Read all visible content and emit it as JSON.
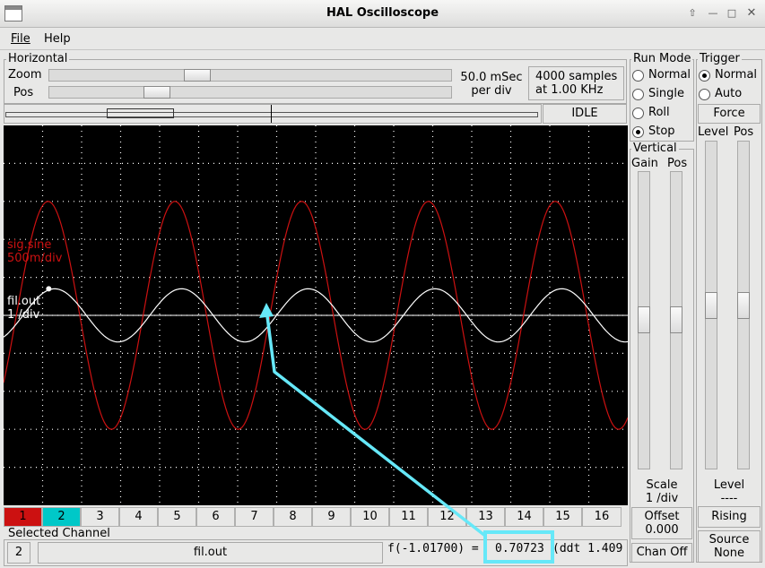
{
  "window": {
    "title": "HAL Oscilloscope"
  },
  "menu": {
    "file": "File",
    "help": "Help"
  },
  "horizontal": {
    "legend": "Horizontal",
    "zoom_label": "Zoom",
    "pos_label": "Pos",
    "timebase": "50.0 mSec",
    "timebase_sub": "per div",
    "samples": "4000 samples",
    "samples_rate": "at 1.00 KHz",
    "zoom_level": 0.36,
    "pos_level": 0.25
  },
  "status": "IDLE",
  "run_mode": {
    "legend": "Run Mode",
    "options": [
      "Normal",
      "Single",
      "Roll",
      "Stop"
    ],
    "selected": "Stop"
  },
  "trigger": {
    "legend": "Trigger",
    "options": [
      "Normal",
      "Auto"
    ],
    "selected": "Normal",
    "force_label": "Force",
    "level_label": "Level",
    "pos_label": "Pos",
    "level_title": "Level",
    "level_value": "----",
    "edge_label": "Rising",
    "source_label": "Source",
    "source_value": "None"
  },
  "vertical": {
    "legend": "Vertical",
    "gain_label": "Gain",
    "pos_label": "Pos",
    "scale_title": "Scale",
    "scale_value": "1 /div",
    "offset_title": "Offset",
    "offset_value": "0.000",
    "chan_off_label": "Chan Off"
  },
  "traces": [
    {
      "name": "sig.sine",
      "scale": "500m/div",
      "color": "#cc1111"
    },
    {
      "name": "fil.out",
      "scale": "1 /div",
      "color": "#ffffff"
    }
  ],
  "channels": [
    "1",
    "2",
    "3",
    "4",
    "5",
    "6",
    "7",
    "8",
    "9",
    "10",
    "11",
    "12",
    "13",
    "14",
    "15",
    "16"
  ],
  "channel_colors": {
    "1": "#cc1111",
    "2": "#00c8c8"
  },
  "selected_channel": {
    "legend": "Selected Channel",
    "number": "2",
    "name": "fil.out",
    "readout_prefix": "f(-1.01700) =",
    "readout_value": "0.70723",
    "readout_suffix": "(ddt  1.409"
  },
  "annotation": {
    "color": "#66e8f8"
  },
  "chart_data": {
    "type": "line",
    "series": [
      {
        "name": "sig.sine",
        "period_div": 3.25,
        "amplitude_div": 3.0,
        "phase_div": 1.14
      },
      {
        "name": "fil.out",
        "period_div": 3.25,
        "amplitude_div": 0.7,
        "phase_div": 1.31
      }
    ],
    "divisions_x": 16,
    "divisions_y": 10,
    "grid": true
  }
}
